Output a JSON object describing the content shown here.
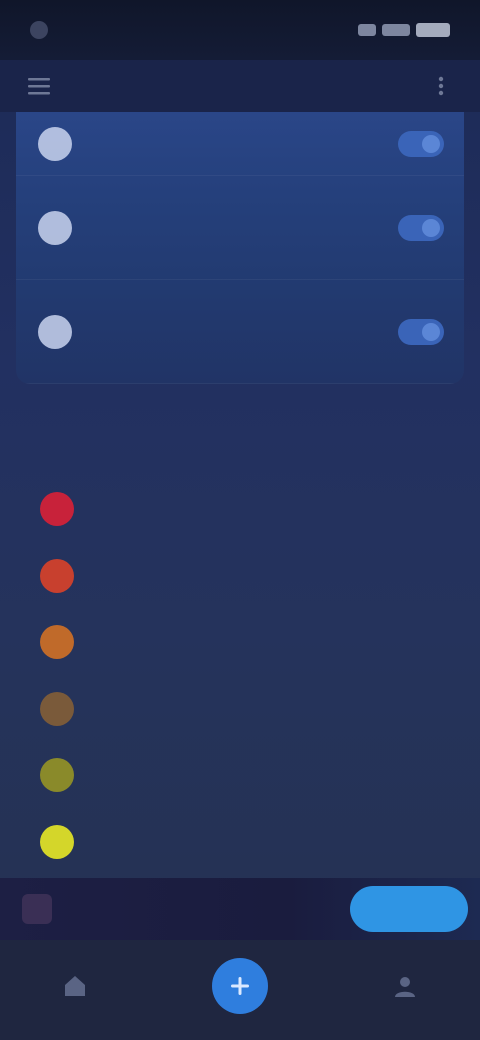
{
  "status_bar": {
    "time": ""
  },
  "header": {
    "title": "",
    "back_icon": "menu-icon",
    "action_icon": "more-icon"
  },
  "cards": [
    {
      "title": "",
      "subtitle": "",
      "icon": "shield-icon",
      "toggle_on": true
    },
    {
      "title": "",
      "subtitle": "",
      "icon": "lock-icon",
      "toggle_on": true
    },
    {
      "title": "",
      "subtitle": "",
      "icon": "bell-icon",
      "toggle_on": true
    }
  ],
  "section": {
    "label": ""
  },
  "list_items": [
    {
      "label": "",
      "color": "#c8223a"
    },
    {
      "label": "",
      "color": "#c8402e"
    },
    {
      "label": "",
      "color": "#c06a2a"
    },
    {
      "label": "",
      "color": "#7a5a3a"
    },
    {
      "label": "",
      "color": "#8a8a2a"
    },
    {
      "label": "",
      "color": "#d4d62a"
    }
  ],
  "banner": {
    "text": "",
    "button_label": ""
  },
  "tabs": [
    {
      "label": "",
      "icon": "home-icon"
    },
    {
      "label": "",
      "icon": "add-icon"
    },
    {
      "label": "",
      "icon": "profile-icon"
    }
  ],
  "colors": {
    "accent": "#2f95e4",
    "card_bg": "#25407c",
    "background": "#223061"
  }
}
